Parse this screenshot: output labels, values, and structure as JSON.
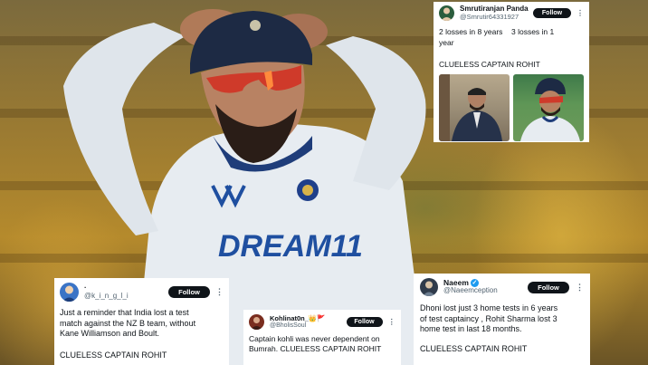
{
  "photo": {
    "jersey_sponsor": "DREAM11",
    "description_icon": "cricket-player-photo"
  },
  "tweets": [
    {
      "name": "Smrutiranjan Panda",
      "handle": "@Smrutir64331927",
      "follow_label": "Follow",
      "more": "⋮",
      "stat_left": "2 losses in 8 years\nyear",
      "stat_right": "3 losses in 1",
      "text": "CLUELESS CAPTAIN ROHIT",
      "has_images": true
    },
    {
      "name": "·",
      "handle": "@k_i_n_g_l_i",
      "follow_label": "Follow",
      "more": "⋮",
      "text": "Just a reminder that India lost a test\nmatch against the NZ B team, without\nKane Williamson and Boult.",
      "clue": "CLUELESS CAPTAIN ROHIT"
    },
    {
      "name": "Kohlinat0n_",
      "name_emoji": "👑🚩",
      "handle": "@BholisSoul",
      "follow_label": "Follow",
      "more": "⋮",
      "text": "Captain kohli was never dependent on\nBumrah. CLUELESS CAPTAIN ROHIT"
    },
    {
      "name": "Naeem",
      "verified": "✓",
      "handle": "@Naeemception",
      "follow_label": "Follow",
      "more": "⋮",
      "text": "Dhoni lost just 3 home tests in 6 years\nof test captaincy , Rohit Sharma lost 3\nhome test in last 18 months.",
      "clue": "CLUELESS CAPTAIN ROHIT"
    }
  ],
  "colors": {
    "card_bg": "#ffffff",
    "follow_bg": "#0f1419",
    "handle_gray": "#536471",
    "verified_blue": "#1d9bf0",
    "jersey": "#e9eef3",
    "jersey_blue": "#1f4fa0"
  }
}
